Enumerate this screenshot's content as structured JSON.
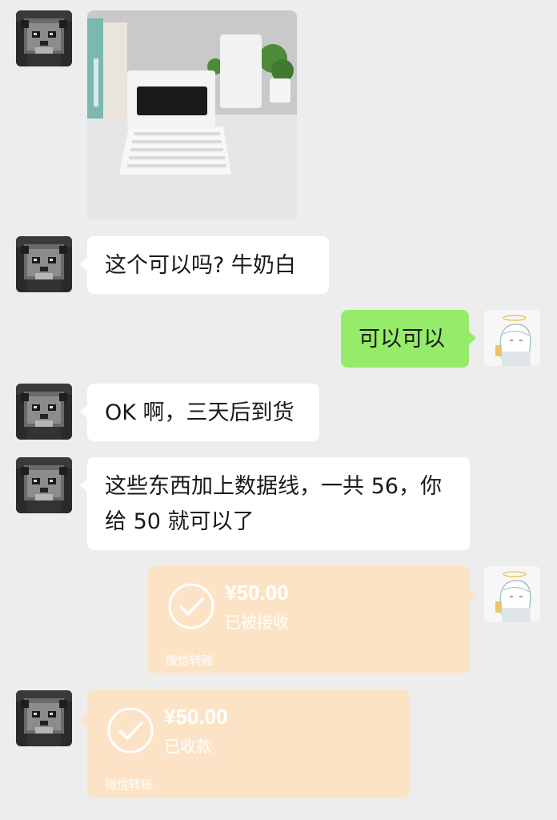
{
  "chat": {
    "messages": [
      {
        "type": "image",
        "side": "left",
        "alt": ""
      },
      {
        "type": "text",
        "side": "left",
        "text": "这个可以吗? 牛奶白"
      },
      {
        "type": "text",
        "side": "right",
        "text": "可以可以"
      },
      {
        "type": "text",
        "side": "left",
        "text": "OK 啊，三天后到货"
      },
      {
        "type": "text",
        "side": "left",
        "line1": "这些东西加上数据线，一共 56，你",
        "line2": "给 50 就可以了"
      },
      {
        "type": "transfer",
        "side": "right",
        "amount": "¥50.00",
        "status": "已被接收",
        "footer": "微信转账"
      },
      {
        "type": "transfer",
        "side": "left",
        "amount": "¥50.00",
        "status": "已收款",
        "footer": "微信转账"
      }
    ]
  },
  "colors": {
    "background": "#ededed",
    "bubble_white": "#ffffff",
    "bubble_green": "#95ec69",
    "transfer_bg": "#fde3c6"
  },
  "icons": {
    "panda_avatar": "pixel-panda-avatar",
    "user_avatar": "anime-angel-avatar",
    "transfer_check": "check-circle-icon"
  }
}
